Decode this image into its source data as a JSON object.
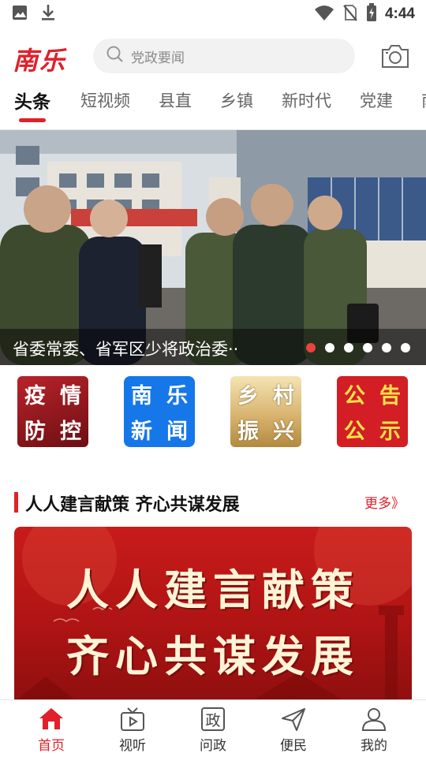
{
  "status_bar": {
    "time": "4:44",
    "icons": [
      "image-icon",
      "download-icon",
      "wifi-icon",
      "no-sim-icon",
      "battery-icon"
    ]
  },
  "header": {
    "logo": "南乐",
    "search_placeholder": "党政要闻",
    "camera_icon": "camera-icon"
  },
  "tabs": [
    {
      "label": "头条",
      "active": true
    },
    {
      "label": "短视频"
    },
    {
      "label": "县直"
    },
    {
      "label": "乡镇"
    },
    {
      "label": "新时代"
    },
    {
      "label": "党建"
    },
    {
      "label": "南"
    }
  ],
  "banner": {
    "caption": "省委常委、省军区少将政治委··",
    "slide_count": 6,
    "active_slide": 1
  },
  "quick_links": [
    {
      "chars": [
        "疫",
        "情",
        "防",
        "控"
      ]
    },
    {
      "chars": [
        "南",
        "乐",
        "新",
        "闻"
      ]
    },
    {
      "chars": [
        "乡",
        "村",
        "振",
        "兴"
      ]
    },
    {
      "chars": [
        "公",
        "告",
        "公",
        "示"
      ]
    }
  ],
  "section": {
    "title": "人人建言献策 齐心共谋发展",
    "more": "更多》"
  },
  "feature": {
    "line1": "人人建言献策",
    "line2": "齐心共谋发展"
  },
  "bottom_nav": [
    {
      "label": "首页",
      "icon": "home-icon",
      "active": true
    },
    {
      "label": "视听",
      "icon": "tv-icon"
    },
    {
      "label": "问政",
      "icon": "zheng-icon",
      "glyph": "政"
    },
    {
      "label": "便民",
      "icon": "send-icon"
    },
    {
      "label": "我的",
      "icon": "user-icon"
    }
  ],
  "colors": {
    "accent": "#e0202a",
    "tile_blue": "#1677e8",
    "dot_active": "#e8453c"
  }
}
